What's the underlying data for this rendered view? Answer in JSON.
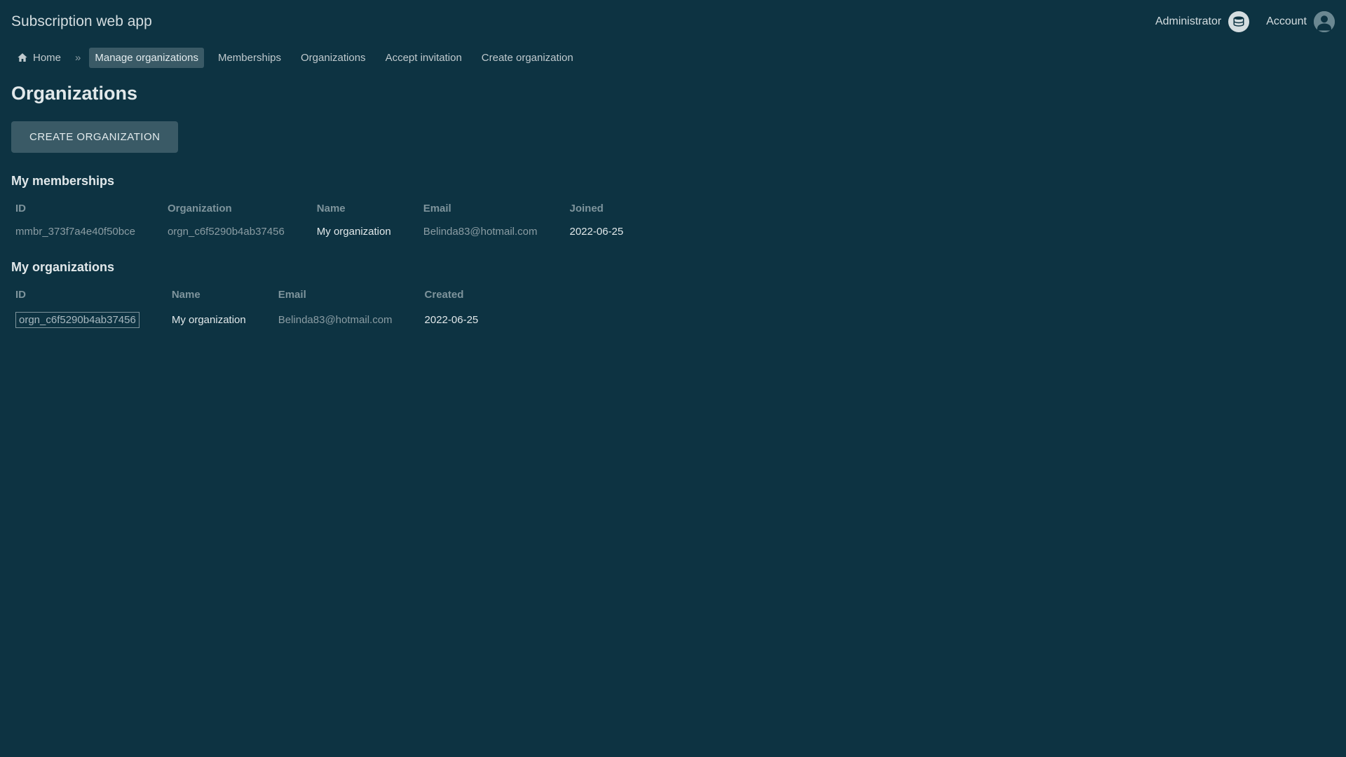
{
  "header": {
    "app_title": "Subscription web app",
    "admin_label": "Administrator",
    "account_label": "Account"
  },
  "nav": {
    "home": "Home",
    "separator": "»",
    "items": [
      {
        "label": "Manage organizations",
        "active": true
      },
      {
        "label": "Memberships",
        "active": false
      },
      {
        "label": "Organizations",
        "active": false
      },
      {
        "label": "Accept invitation",
        "active": false
      },
      {
        "label": "Create organization",
        "active": false
      }
    ]
  },
  "page": {
    "title": "Organizations",
    "create_button": "CREATE ORGANIZATION"
  },
  "memberships": {
    "section_title": "My memberships",
    "columns": {
      "id": "ID",
      "organization": "Organization",
      "name": "Name",
      "email": "Email",
      "joined": "Joined"
    },
    "rows": [
      {
        "id": "mmbr_373f7a4e40f50bce",
        "organization": "orgn_c6f5290b4ab37456",
        "name": "My organization",
        "email": "Belinda83@hotmail.com",
        "joined": "2022-06-25"
      }
    ]
  },
  "organizations": {
    "section_title": "My organizations",
    "columns": {
      "id": "ID",
      "name": "Name",
      "email": "Email",
      "created": "Created"
    },
    "rows": [
      {
        "id": "orgn_c6f5290b4ab37456",
        "name": "My organization",
        "email": "Belinda83@hotmail.com",
        "created": "2022-06-25"
      }
    ]
  }
}
